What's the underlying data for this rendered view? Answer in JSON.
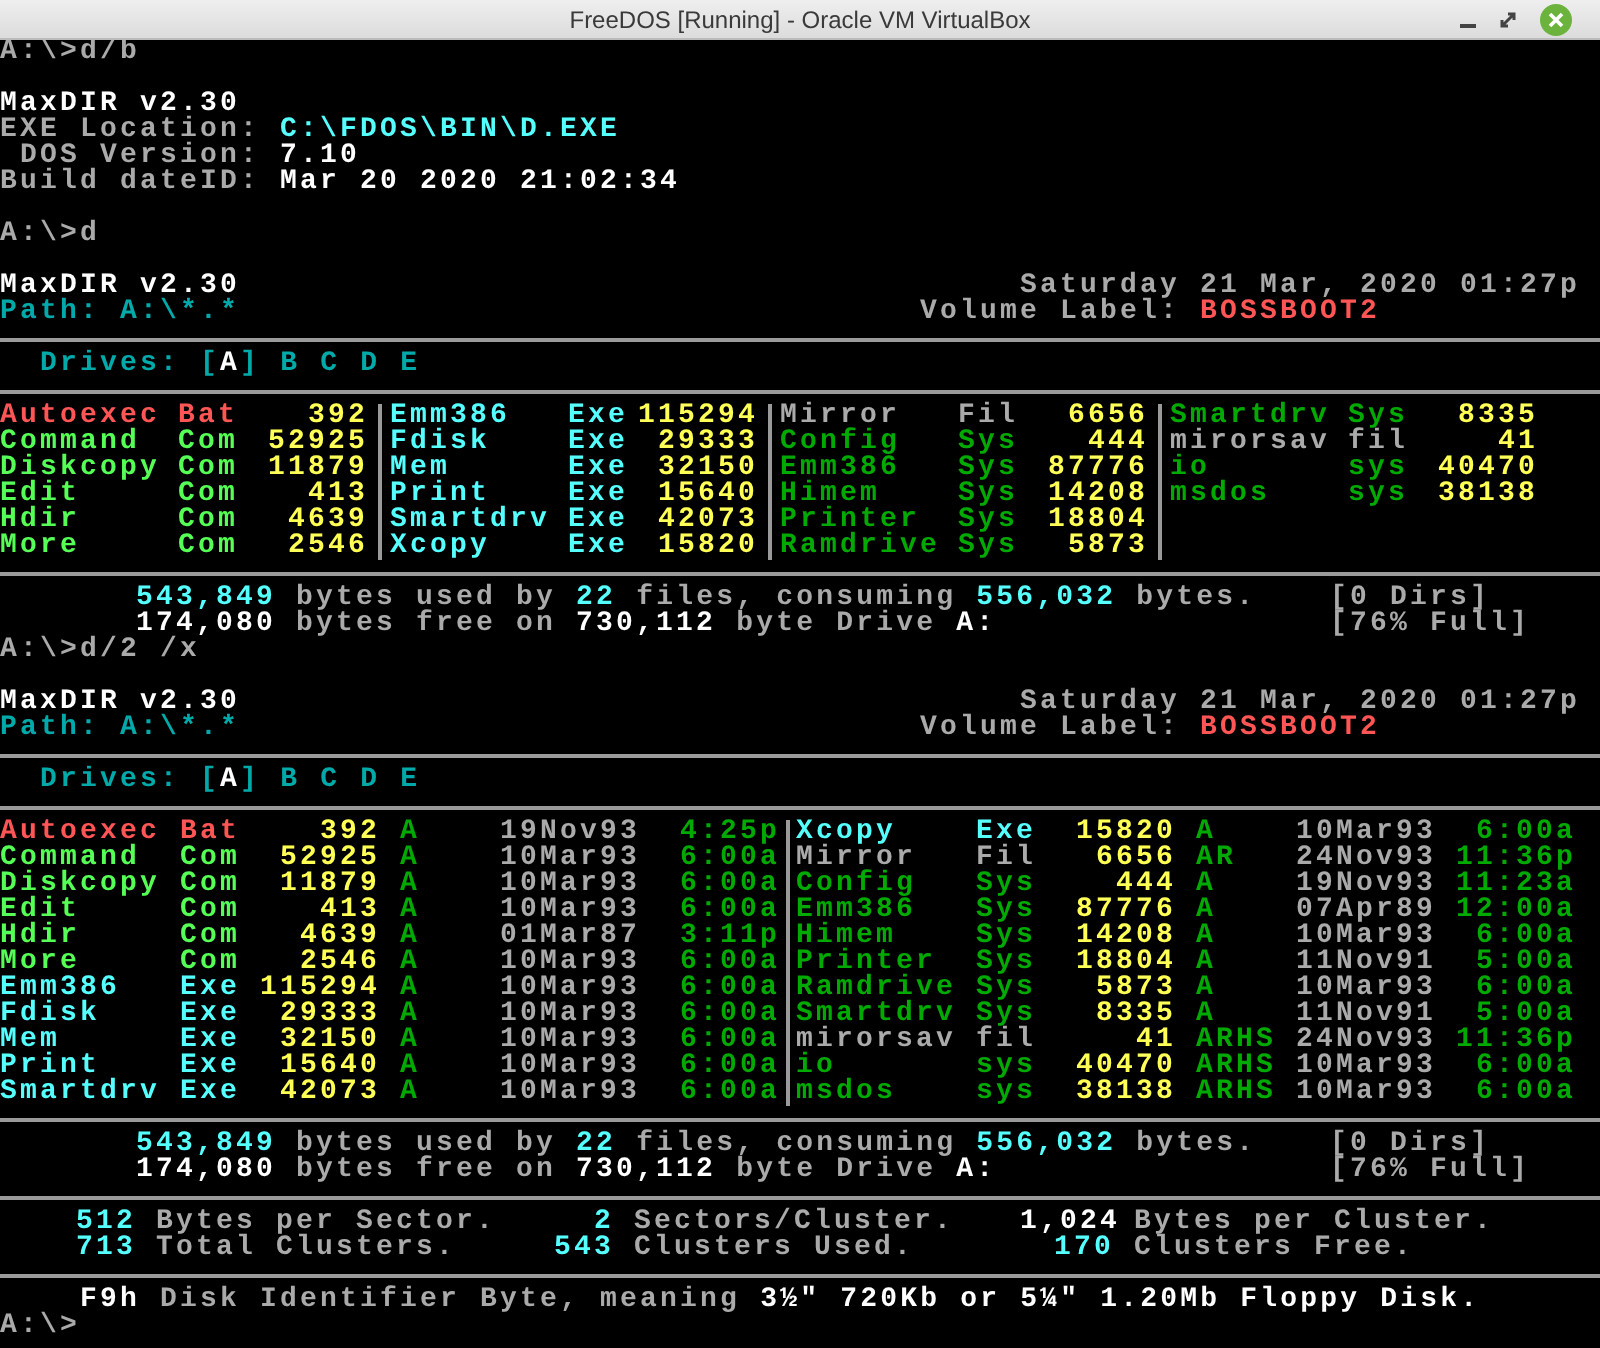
{
  "window": {
    "title": "FreeDOS [Running] - Oracle VM VirtualBox"
  },
  "blocks": [
    {
      "kind": "prompt",
      "text": "A:\\>d/b"
    },
    {
      "kind": "version",
      "title": "MaxDIR v2.30",
      "fields": [
        {
          "label": "EXE Location:",
          "value": "C:\\FDOS\\BIN\\D.EXE",
          "kind": "path"
        },
        {
          "label": "DOS Version:",
          "value": "7.10",
          "kind": "text"
        },
        {
          "label": "Build dateID:",
          "value": "Mar 20 2020 21:02:34",
          "kind": "text"
        }
      ]
    },
    {
      "kind": "prompt",
      "text": "A:\\>d"
    },
    {
      "kind": "wide_listing",
      "title": "MaxDIR v2.30",
      "date": "Saturday 21 Mar, 2020 01:27p",
      "path": "Path: A:\\*.*",
      "volume_label": "Volume Label:",
      "volume": "BOSSBOOT2",
      "drives": {
        "label": "Drives:",
        "bracket_left": "[",
        "bracket_right": "]",
        "items": [
          {
            "label": "A",
            "selected": true
          },
          {
            "label": "B",
            "selected": false
          },
          {
            "label": "C",
            "selected": false
          },
          {
            "label": "D",
            "selected": false
          },
          {
            "label": "E",
            "selected": false
          }
        ]
      },
      "columns": [
        {
          "files": [
            {
              "name": "Autoexec",
              "ext": "Bat",
              "size": "392",
              "color": "#ff5555"
            },
            {
              "name": "Command",
              "ext": "Com",
              "size": "52925",
              "color": "#55ff55"
            },
            {
              "name": "Diskcopy",
              "ext": "Com",
              "size": "11879",
              "color": "#55ff55"
            },
            {
              "name": "Edit",
              "ext": "Com",
              "size": "413",
              "color": "#55ff55"
            },
            {
              "name": "Hdir",
              "ext": "Com",
              "size": "4639",
              "color": "#55ff55"
            },
            {
              "name": "More",
              "ext": "Com",
              "size": "2546",
              "color": "#55ff55"
            }
          ]
        },
        {
          "files": [
            {
              "name": "Emm386",
              "ext": "Exe",
              "size": "115294",
              "color": "#55ffff"
            },
            {
              "name": "Fdisk",
              "ext": "Exe",
              "size": "29333",
              "color": "#55ffff"
            },
            {
              "name": "Mem",
              "ext": "Exe",
              "size": "32150",
              "color": "#55ffff"
            },
            {
              "name": "Print",
              "ext": "Exe",
              "size": "15640",
              "color": "#55ffff"
            },
            {
              "name": "Smartdrv",
              "ext": "Exe",
              "size": "42073",
              "color": "#55ffff"
            },
            {
              "name": "Xcopy",
              "ext": "Exe",
              "size": "15820",
              "color": "#55ffff"
            }
          ]
        },
        {
          "files": [
            {
              "name": "Mirror",
              "ext": "Fil",
              "size": "6656",
              "color": "#aaaaaa"
            },
            {
              "name": "Config",
              "ext": "Sys",
              "size": "444",
              "color": "#00aa00"
            },
            {
              "name": "Emm386",
              "ext": "Sys",
              "size": "87776",
              "color": "#00aa00"
            },
            {
              "name": "Himem",
              "ext": "Sys",
              "size": "14208",
              "color": "#00aa00"
            },
            {
              "name": "Printer",
              "ext": "Sys",
              "size": "18804",
              "color": "#00aa00"
            },
            {
              "name": "Ramdrive",
              "ext": "Sys",
              "size": "5873",
              "color": "#00aa00"
            }
          ]
        },
        {
          "files": [
            {
              "name": "Smartdrv",
              "ext": "Sys",
              "size": "8335",
              "color": "#00aa00"
            },
            {
              "name": "mirorsav",
              "ext": "fil",
              "size": "41",
              "color": "#aaaaaa"
            },
            {
              "name": "io",
              "ext": "sys",
              "size": "40470",
              "color": "#00aa00"
            },
            {
              "name": "msdos",
              "ext": "sys",
              "size": "38138",
              "color": "#00aa00"
            }
          ]
        }
      ],
      "summary": [
        {
          "parts": [
            {
              "text": "543,849",
              "kind": "value"
            },
            {
              "text": "bytes used by",
              "kind": "label"
            },
            {
              "text": "22",
              "kind": "value"
            },
            {
              "text": "files, consuming",
              "kind": "label"
            },
            {
              "text": "556,032",
              "kind": "value"
            },
            {
              "text": "bytes.",
              "kind": "label"
            }
          ],
          "note": "[0 Dirs]"
        },
        {
          "parts": [
            {
              "text": "174,080",
              "kind": "bright"
            },
            {
              "text": "bytes free on",
              "kind": "label"
            },
            {
              "text": "730,112",
              "kind": "bright"
            },
            {
              "text": "byte Drive",
              "kind": "label"
            },
            {
              "text": "A:",
              "kind": "bright"
            }
          ],
          "note": "[76% Full]"
        }
      ]
    },
    {
      "kind": "prompt",
      "text": "A:\\>d/2 /x"
    },
    {
      "kind": "detailed_listing",
      "title": "MaxDIR v2.30",
      "date": "Saturday 21 Mar, 2020 01:27p",
      "path": "Path: A:\\*.*",
      "volume_label": "Volume Label:",
      "volume": "BOSSBOOT2",
      "drives": {
        "label": "Drives:",
        "bracket_left": "[",
        "bracket_right": "]",
        "items": [
          {
            "label": "A",
            "selected": true
          },
          {
            "label": "B",
            "selected": false
          },
          {
            "label": "C",
            "selected": false
          },
          {
            "label": "D",
            "selected": false
          },
          {
            "label": "E",
            "selected": false
          }
        ]
      },
      "columns": [
        {
          "files": [
            {
              "name": "Autoexec",
              "ext": "Bat",
              "size": "392",
              "attributes": "A",
              "date": "19Nov93",
              "time": "4:25p",
              "color": "#ff5555"
            },
            {
              "name": "Command",
              "ext": "Com",
              "size": "52925",
              "attributes": "A",
              "date": "10Mar93",
              "time": "6:00a",
              "color": "#55ff55"
            },
            {
              "name": "Diskcopy",
              "ext": "Com",
              "size": "11879",
              "attributes": "A",
              "date": "10Mar93",
              "time": "6:00a",
              "color": "#55ff55"
            },
            {
              "name": "Edit",
              "ext": "Com",
              "size": "413",
              "attributes": "A",
              "date": "10Mar93",
              "time": "6:00a",
              "color": "#55ff55"
            },
            {
              "name": "Hdir",
              "ext": "Com",
              "size": "4639",
              "attributes": "A",
              "date": "01Mar87",
              "time": "3:11p",
              "color": "#55ff55"
            },
            {
              "name": "More",
              "ext": "Com",
              "size": "2546",
              "attributes": "A",
              "date": "10Mar93",
              "time": "6:00a",
              "color": "#55ff55"
            },
            {
              "name": "Emm386",
              "ext": "Exe",
              "size": "115294",
              "attributes": "A",
              "date": "10Mar93",
              "time": "6:00a",
              "color": "#55ffff"
            },
            {
              "name": "Fdisk",
              "ext": "Exe",
              "size": "29333",
              "attributes": "A",
              "date": "10Mar93",
              "time": "6:00a",
              "color": "#55ffff"
            },
            {
              "name": "Mem",
              "ext": "Exe",
              "size": "32150",
              "attributes": "A",
              "date": "10Mar93",
              "time": "6:00a",
              "color": "#55ffff"
            },
            {
              "name": "Print",
              "ext": "Exe",
              "size": "15640",
              "attributes": "A",
              "date": "10Mar93",
              "time": "6:00a",
              "color": "#55ffff"
            },
            {
              "name": "Smartdrv",
              "ext": "Exe",
              "size": "42073",
              "attributes": "A",
              "date": "10Mar93",
              "time": "6:00a",
              "color": "#55ffff"
            }
          ]
        },
        {
          "files": [
            {
              "name": "Xcopy",
              "ext": "Exe",
              "size": "15820",
              "attributes": "A",
              "date": "10Mar93",
              "time": "6:00a",
              "color": "#55ffff"
            },
            {
              "name": "Mirror",
              "ext": "Fil",
              "size": "6656",
              "attributes": "AR",
              "date": "24Nov93",
              "time": "11:36p",
              "color": "#aaaaaa"
            },
            {
              "name": "Config",
              "ext": "Sys",
              "size": "444",
              "attributes": "A",
              "date": "19Nov93",
              "time": "11:23a",
              "color": "#00aa00"
            },
            {
              "name": "Emm386",
              "ext": "Sys",
              "size": "87776",
              "attributes": "A",
              "date": "07Apr89",
              "time": "12:00a",
              "color": "#00aa00"
            },
            {
              "name": "Himem",
              "ext": "Sys",
              "size": "14208",
              "attributes": "A",
              "date": "10Mar93",
              "time": "6:00a",
              "color": "#00aa00"
            },
            {
              "name": "Printer",
              "ext": "Sys",
              "size": "18804",
              "attributes": "A",
              "date": "11Nov91",
              "time": "5:00a",
              "color": "#00aa00"
            },
            {
              "name": "Ramdrive",
              "ext": "Sys",
              "size": "5873",
              "attributes": "A",
              "date": "10Mar93",
              "time": "6:00a",
              "color": "#00aa00"
            },
            {
              "name": "Smartdrv",
              "ext": "Sys",
              "size": "8335",
              "attributes": "A",
              "date": "11Nov91",
              "time": "5:00a",
              "color": "#00aa00"
            },
            {
              "name": "mirorsav",
              "ext": "fil",
              "size": "41",
              "attributes": "ARHS",
              "date": "24Nov93",
              "time": "11:36p",
              "color": "#aaaaaa"
            },
            {
              "name": "io",
              "ext": "sys",
              "size": "40470",
              "attributes": "ARHS",
              "date": "10Mar93",
              "time": "6:00a",
              "color": "#00aa00"
            },
            {
              "name": "msdos",
              "ext": "sys",
              "size": "38138",
              "attributes": "ARHS",
              "date": "10Mar93",
              "time": "6:00a",
              "color": "#00aa00"
            }
          ]
        }
      ],
      "summary": [
        {
          "parts": [
            {
              "text": "543,849",
              "kind": "value"
            },
            {
              "text": "bytes used by",
              "kind": "label"
            },
            {
              "text": "22",
              "kind": "value"
            },
            {
              "text": "files, consuming",
              "kind": "label"
            },
            {
              "text": "556,032",
              "kind": "value"
            },
            {
              "text": "bytes.",
              "kind": "label"
            }
          ],
          "note": "[0 Dirs]"
        },
        {
          "parts": [
            {
              "text": "174,080",
              "kind": "bright"
            },
            {
              "text": "bytes free on",
              "kind": "label"
            },
            {
              "text": "730,112",
              "kind": "bright"
            },
            {
              "text": "byte Drive",
              "kind": "label"
            },
            {
              "text": "A:",
              "kind": "bright"
            }
          ],
          "note": "[76% Full]"
        }
      ]
    },
    {
      "kind": "disk_info",
      "stat_rows": [
        {
          "stats": [
            {
              "value": "512",
              "label": "Bytes per Sector.",
              "kind": "value"
            },
            {
              "value": "2",
              "label": "Sectors/Cluster.",
              "kind": "value"
            },
            {
              "value": "1,024",
              "label": "Bytes per Cluster.",
              "kind": "bright"
            }
          ]
        },
        {
          "stats": [
            {
              "value": "713",
              "label": "Total Clusters.",
              "kind": "value"
            },
            {
              "value": "543",
              "label": "Clusters Used.",
              "kind": "value"
            },
            {
              "value": "170",
              "label": "Clusters Free.",
              "kind": "value"
            }
          ]
        }
      ],
      "identifier": [
        {
          "text": "F9h",
          "kind": "bright"
        },
        {
          "text": "Disk Identifier Byte, meaning",
          "kind": "label"
        },
        {
          "text": "3½\" 720Kb or 5¼\" 1.20Mb Floppy Disk.",
          "kind": "bright"
        }
      ]
    },
    {
      "kind": "prompt",
      "text": "A:\\>"
    }
  ]
}
